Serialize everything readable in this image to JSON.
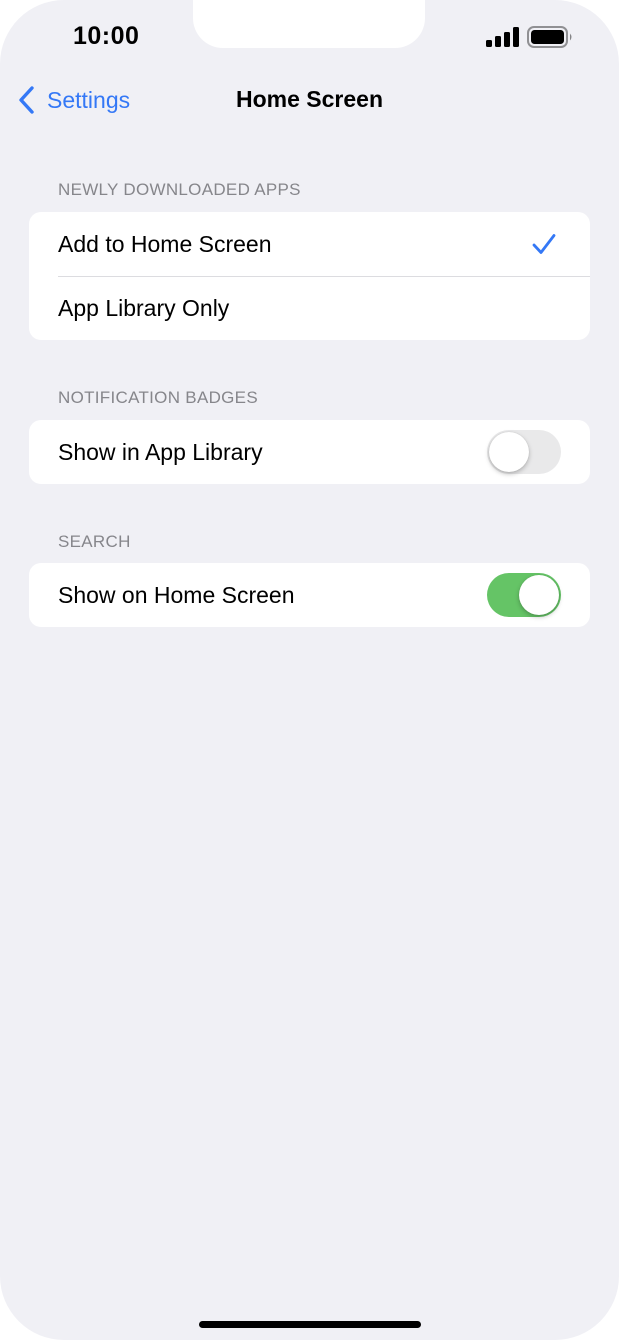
{
  "status_bar": {
    "time": "10:00",
    "signal_icon": "cellular-signal-icon",
    "battery_icon": "battery-icon"
  },
  "nav": {
    "back_label": "Settings",
    "back_icon": "chevron-left-icon",
    "title": "Home Screen"
  },
  "sections": {
    "downloaded": {
      "header": "NEWLY DOWNLOADED APPS",
      "options": [
        {
          "label": "Add to Home Screen",
          "selected": true
        },
        {
          "label": "App Library Only",
          "selected": false
        }
      ]
    },
    "badges": {
      "header": "NOTIFICATION BADGES",
      "label": "Show in App Library",
      "enabled": false
    },
    "search": {
      "header": "SEARCH",
      "label": "Show on Home Screen",
      "enabled": true
    }
  },
  "colors": {
    "accent": "#3478f6",
    "toggle_on": "#65c466",
    "toggle_off": "#e9e9ea",
    "background": "#f0f0f5"
  }
}
